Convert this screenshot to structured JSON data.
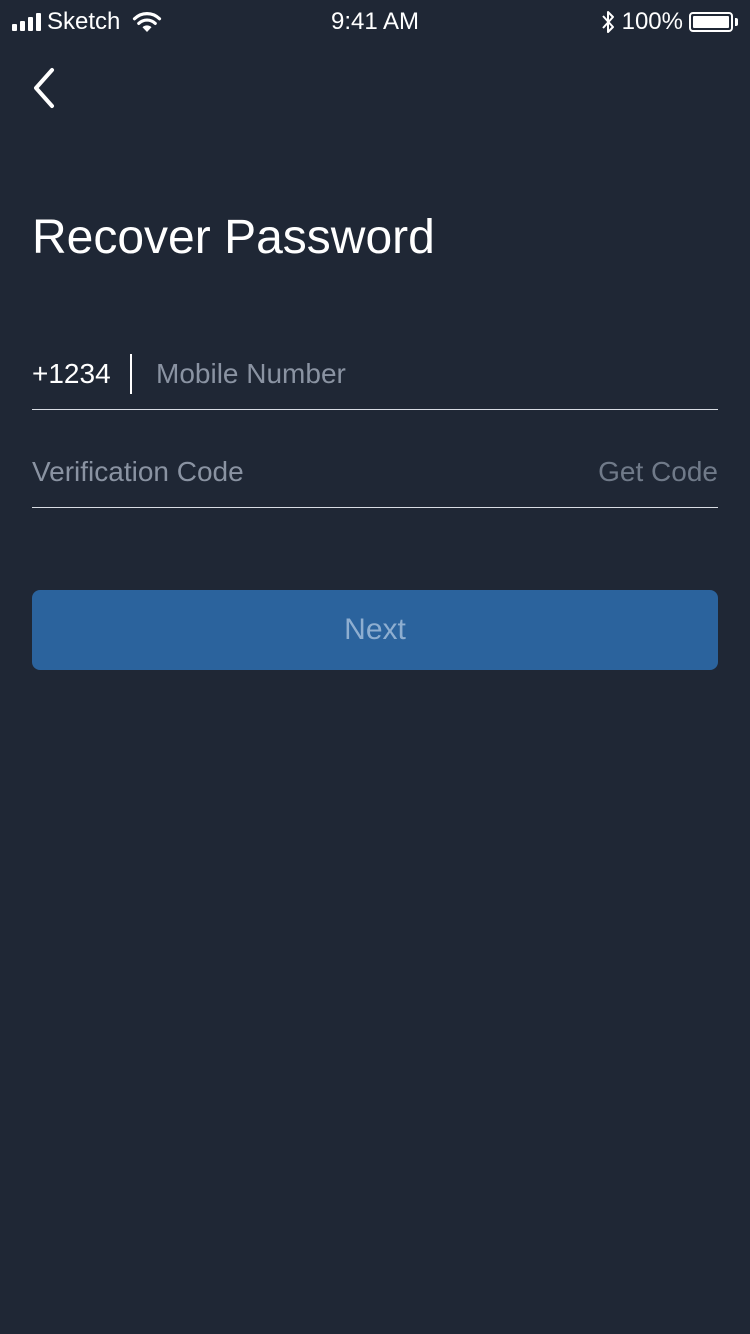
{
  "status_bar": {
    "carrier": "Sketch",
    "time": "9:41 AM",
    "battery_percent": "100%",
    "battery_level": 1.0,
    "signal_bars": 4
  },
  "nav": {
    "back_icon": "chevron-left-icon"
  },
  "page": {
    "title": "Recover Password"
  },
  "form": {
    "country_code": "+1234",
    "mobile_placeholder": "Mobile Number",
    "mobile_value": "",
    "code_placeholder": "Verification Code",
    "code_value": "",
    "get_code_label": "Get Code",
    "next_label": "Next"
  },
  "colors": {
    "background": "#1f2735",
    "primary_button": "#2b639d",
    "button_text": "#8eaed0",
    "placeholder": "#8a93a2"
  }
}
